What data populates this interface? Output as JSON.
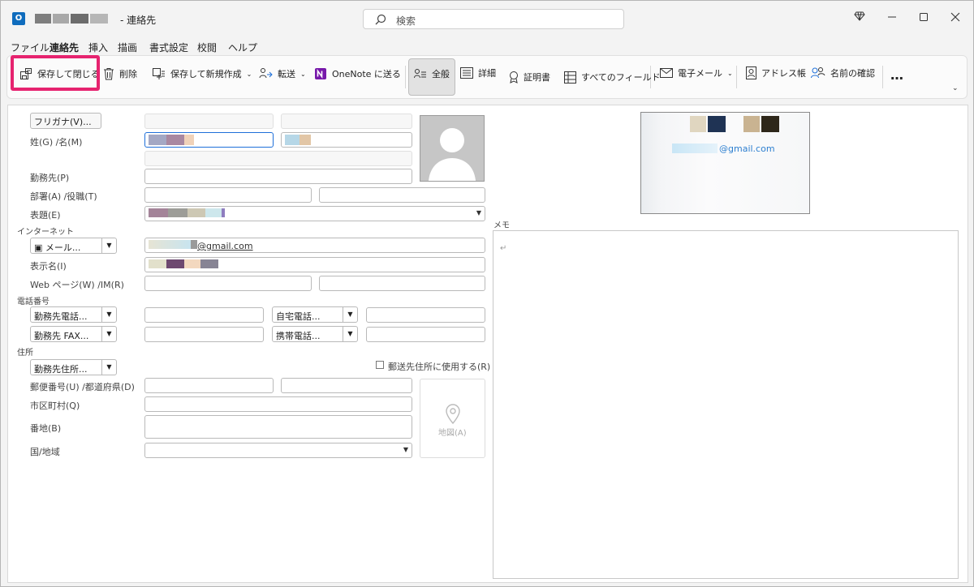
{
  "window": {
    "title": "連絡先",
    "title_prefix": "-"
  },
  "search": {
    "placeholder": "検索"
  },
  "menu": [
    "ファイル",
    "連絡先",
    "挿入",
    "描画",
    "書式設定",
    "校閲",
    "ヘルプ"
  ],
  "ribbon": {
    "save_close": "保存して閉じる",
    "delete": "削除",
    "save_new": "保存して新規作成",
    "forward": "転送",
    "onenote": "OneNote に送る",
    "general": "全般",
    "details": "詳細",
    "certificates": "証明書",
    "all_fields": "すべてのフィールド",
    "email": "電子メール",
    "address_book": "アドレス帳",
    "check_names": "名前の確認",
    "more": "…"
  },
  "form": {
    "furigana_btn": "フリガナ(V)...",
    "name_label": "姓(G) /名(M)",
    "company_label": "勤務先(P)",
    "dept_label": "部署(A) /役職(T)",
    "fileas_label": "表題(E)",
    "internet_section": "インターネット",
    "email_dd": "メール...",
    "email_value": "@gmail.com",
    "display_label": "表示名(I)",
    "web_label": "Web ページ(W) /IM(R)",
    "phone_section": "電話番号",
    "phone1": "勤務先電話...",
    "phone2": "自宅電話...",
    "phone3": "勤務先 FAX...",
    "phone4": "携帯電話...",
    "address_section": "住所",
    "address_dd": "勤務先住所...",
    "mailing_chk": "郵送先住所に使用する(R)",
    "zip_label": "郵便番号(U) /都道府県(D)",
    "city_label": "市区町村(Q)",
    "street_label": "番地(B)",
    "country_label": "国/地域",
    "map_label": "地図(A)"
  },
  "card": {
    "email": "@gmail.com"
  },
  "memo": {
    "label": "メモ",
    "content": "↵"
  }
}
